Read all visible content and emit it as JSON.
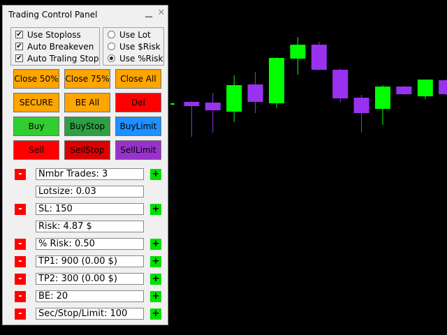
{
  "panel": {
    "title": "Trading Control Panel",
    "minimize_icon": "minimize-icon",
    "close_icon": "close-icon"
  },
  "options": {
    "checkboxes": [
      {
        "label": "Use Stoploss",
        "checked": true
      },
      {
        "label": "Auto Breakeven",
        "checked": true
      },
      {
        "label": "Auto Traling Stop",
        "checked": true
      }
    ],
    "radios": [
      {
        "label": "Use Lot",
        "selected": false
      },
      {
        "label": "Use $Risk",
        "selected": false
      },
      {
        "label": "Use %Risk",
        "selected": true
      }
    ]
  },
  "buttons": {
    "close50": {
      "label": "Close 50%",
      "color": "#ffa500"
    },
    "close75": {
      "label": "Close 75%",
      "color": "#ffa500"
    },
    "closeAll": {
      "label": "Close All",
      "color": "#ffa500"
    },
    "secure": {
      "label": "SECURE",
      "color": "#ffa500"
    },
    "beAll": {
      "label": "BE All",
      "color": "#ffa500"
    },
    "del": {
      "label": "Del",
      "color": "#ff0000"
    },
    "buy": {
      "label": "Buy",
      "color": "#32cd32"
    },
    "buyStop": {
      "label": "BuyStop",
      "color": "#2ea043"
    },
    "buyLimit": {
      "label": "BuyLimit",
      "color": "#1e90ff"
    },
    "sell": {
      "label": "Sell",
      "color": "#ff0000"
    },
    "sellStop": {
      "label": "SellStop",
      "color": "#dd0000"
    },
    "sellLimit": {
      "label": "SellLimit",
      "color": "#9932cc"
    }
  },
  "fields": {
    "nmbr_trades": "Nmbr Trades: 3",
    "lotsize": "Lotsize: 0.03",
    "sl": "SL: 150",
    "risk": "Risk: 4.87 $",
    "pct_risk": "% Risk: 0.50",
    "tp1": "TP1: 900 (0.00 $)",
    "tp2": "TP2: 300 (0.00 $)",
    "be": "BE: 20",
    "sec_stop_limit": "Sec/Stop/Limit: 100"
  },
  "steppers": {
    "minus": "-",
    "plus": "+"
  },
  "colors": {
    "bull": "#00ff00",
    "bear": "#9932f0",
    "background": "#000000"
  },
  "chart_data": {
    "type": "candlestick",
    "candles": [
      {
        "o": 148,
        "c": 148,
        "h": 148,
        "l": 148,
        "dir": "bull"
      },
      {
        "o": 146,
        "c": 152,
        "h": 145,
        "l": 196,
        "dir": "bear"
      },
      {
        "o": 147,
        "c": 158,
        "h": 133,
        "l": 190,
        "dir": "bear"
      },
      {
        "o": 160,
        "c": 122,
        "h": 108,
        "l": 175,
        "dir": "bull"
      },
      {
        "o": 121,
        "c": 146,
        "h": 103,
        "l": 162,
        "dir": "bear"
      },
      {
        "o": 148,
        "c": 83,
        "h": 82,
        "l": 155,
        "dir": "bull"
      },
      {
        "o": 84,
        "c": 64,
        "h": 53,
        "l": 107,
        "dir": "bull"
      },
      {
        "o": 64,
        "c": 100,
        "h": 60,
        "l": 101,
        "dir": "bear"
      },
      {
        "o": 100,
        "c": 141,
        "h": 98,
        "l": 147,
        "dir": "bear"
      },
      {
        "o": 140,
        "c": 162,
        "h": 136,
        "l": 190,
        "dir": "bear"
      },
      {
        "o": 156,
        "c": 124,
        "h": 122,
        "l": 179,
        "dir": "bull"
      },
      {
        "o": 124,
        "c": 135,
        "h": 123,
        "l": 136,
        "dir": "bear"
      },
      {
        "o": 138,
        "c": 114,
        "h": 114,
        "l": 142,
        "dir": "bull"
      },
      {
        "o": 115,
        "c": 135,
        "h": 114,
        "l": 136,
        "dir": "bear"
      },
      {
        "o": 134,
        "c": 94,
        "h": 93,
        "l": 135,
        "dir": "bull"
      }
    ]
  }
}
